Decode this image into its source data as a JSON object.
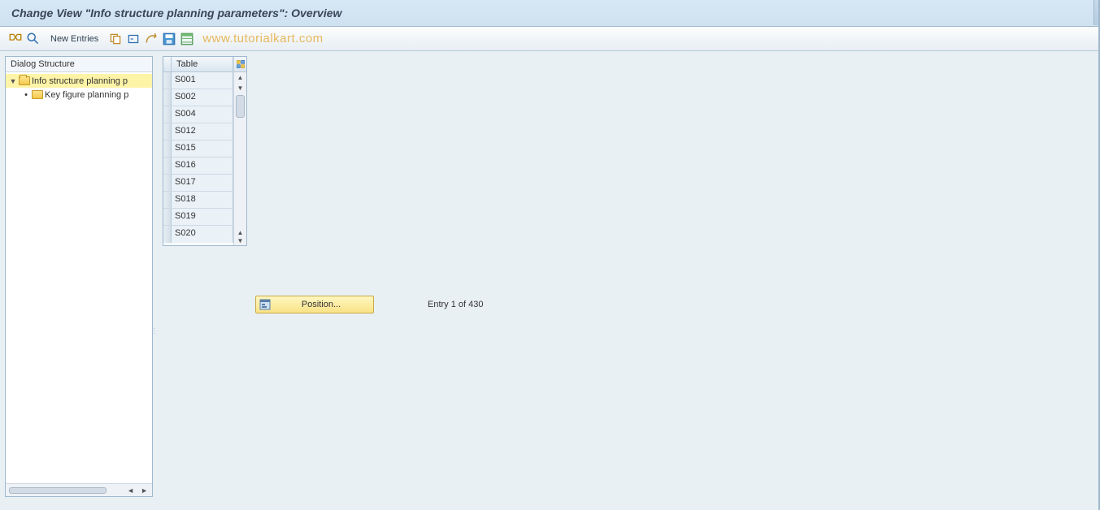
{
  "title": "Change View \"Info structure planning parameters\": Overview",
  "toolbar": {
    "new_entries_label": "New Entries"
  },
  "watermark": "www.tutorialkart.com",
  "tree": {
    "header": "Dialog Structure",
    "root_label": "Info structure planning p",
    "child_label": "Key figure planning p"
  },
  "table": {
    "header": "Table",
    "rows": [
      "S001",
      "S002",
      "S004",
      "S012",
      "S015",
      "S016",
      "S017",
      "S018",
      "S019",
      "S020"
    ]
  },
  "position": {
    "button_label": "Position...",
    "status": "Entry 1 of 430"
  }
}
